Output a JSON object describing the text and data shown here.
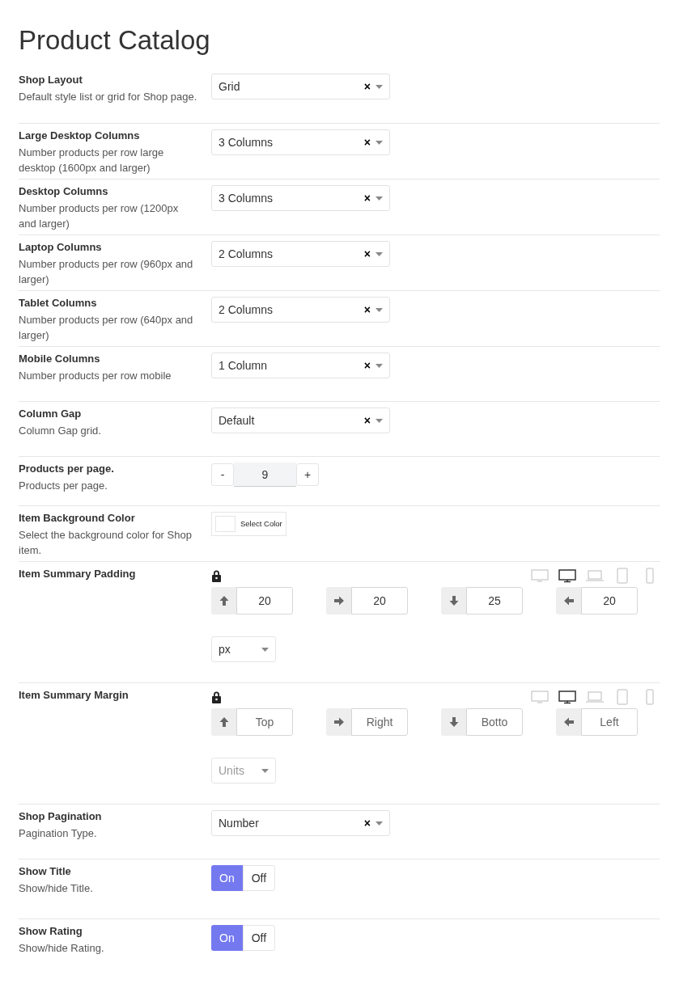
{
  "title": "Product Catalog",
  "settings": [
    {
      "kind": "select",
      "label": "Shop Layout",
      "description": "Default style list or grid for Shop page.",
      "value": "Grid",
      "clear": "×"
    },
    {
      "kind": "select",
      "label": "Large Desktop Columns",
      "description": "Number products per row large desktop (1600px and larger)",
      "value": "3 Columns",
      "clear": "×"
    },
    {
      "kind": "select",
      "label": "Desktop Columns",
      "description": "Number products per row (1200px and larger)",
      "value": "3 Columns",
      "clear": "×"
    },
    {
      "kind": "select",
      "label": "Laptop Columns",
      "description": "Number products per row (960px and larger)",
      "value": "2 Columns",
      "clear": "×"
    },
    {
      "kind": "select",
      "label": "Tablet Columns",
      "description": "Number products per row (640px and larger)",
      "value": "2 Columns",
      "clear": "×"
    },
    {
      "kind": "select",
      "label": "Mobile Columns",
      "description": "Number products per row mobile",
      "value": "1 Column",
      "clear": "×"
    },
    {
      "kind": "select",
      "label": "Column Gap",
      "description": "Column Gap grid.",
      "value": "Default",
      "clear": "×"
    },
    {
      "kind": "stepper",
      "label": "Products per page.",
      "description": "Products per page.",
      "minus": "-",
      "value": "9",
      "plus": "+"
    },
    {
      "kind": "color",
      "label": "Item Background Color",
      "description": "Select the background color for Shop item.",
      "button": "Select Color"
    },
    {
      "kind": "spacing",
      "label": "Item Summary Padding",
      "devices": [
        {
          "selected": false
        },
        {
          "selected": true
        },
        {
          "selected": false
        },
        {
          "selected": false
        },
        {
          "selected": false
        }
      ],
      "sides": [
        {
          "kind": "up",
          "value": "20"
        },
        {
          "kind": "right",
          "value": "20"
        },
        {
          "kind": "down",
          "value": "25"
        },
        {
          "kind": "left",
          "value": "20"
        }
      ],
      "unit": {
        "value": "px"
      }
    },
    {
      "kind": "spacing",
      "label": "Item Summary Margin",
      "devices": [
        {
          "selected": false
        },
        {
          "selected": true
        },
        {
          "selected": false
        },
        {
          "selected": false
        },
        {
          "selected": false
        }
      ],
      "sides": [
        {
          "kind": "up",
          "placeholder": "Top"
        },
        {
          "kind": "right",
          "placeholder": "Right"
        },
        {
          "kind": "down",
          "placeholder": "Botto"
        },
        {
          "kind": "left",
          "placeholder": "Left"
        }
      ],
      "unit": {
        "placeholder": "Units"
      }
    },
    {
      "kind": "select",
      "label": "Shop Pagination",
      "description": "Pagination Type.",
      "value": "Number",
      "clear": "×"
    },
    {
      "kind": "toggle",
      "label": "Show Title",
      "description": "Show/hide Title.",
      "options": [
        {
          "label": "On",
          "selected": true
        },
        {
          "label": "Off",
          "selected": false
        }
      ]
    },
    {
      "kind": "toggle",
      "label": "Show Rating",
      "description": "Show/hide Rating.",
      "options": [
        {
          "label": "On",
          "selected": true
        },
        {
          "label": "Off",
          "selected": false
        }
      ]
    }
  ]
}
